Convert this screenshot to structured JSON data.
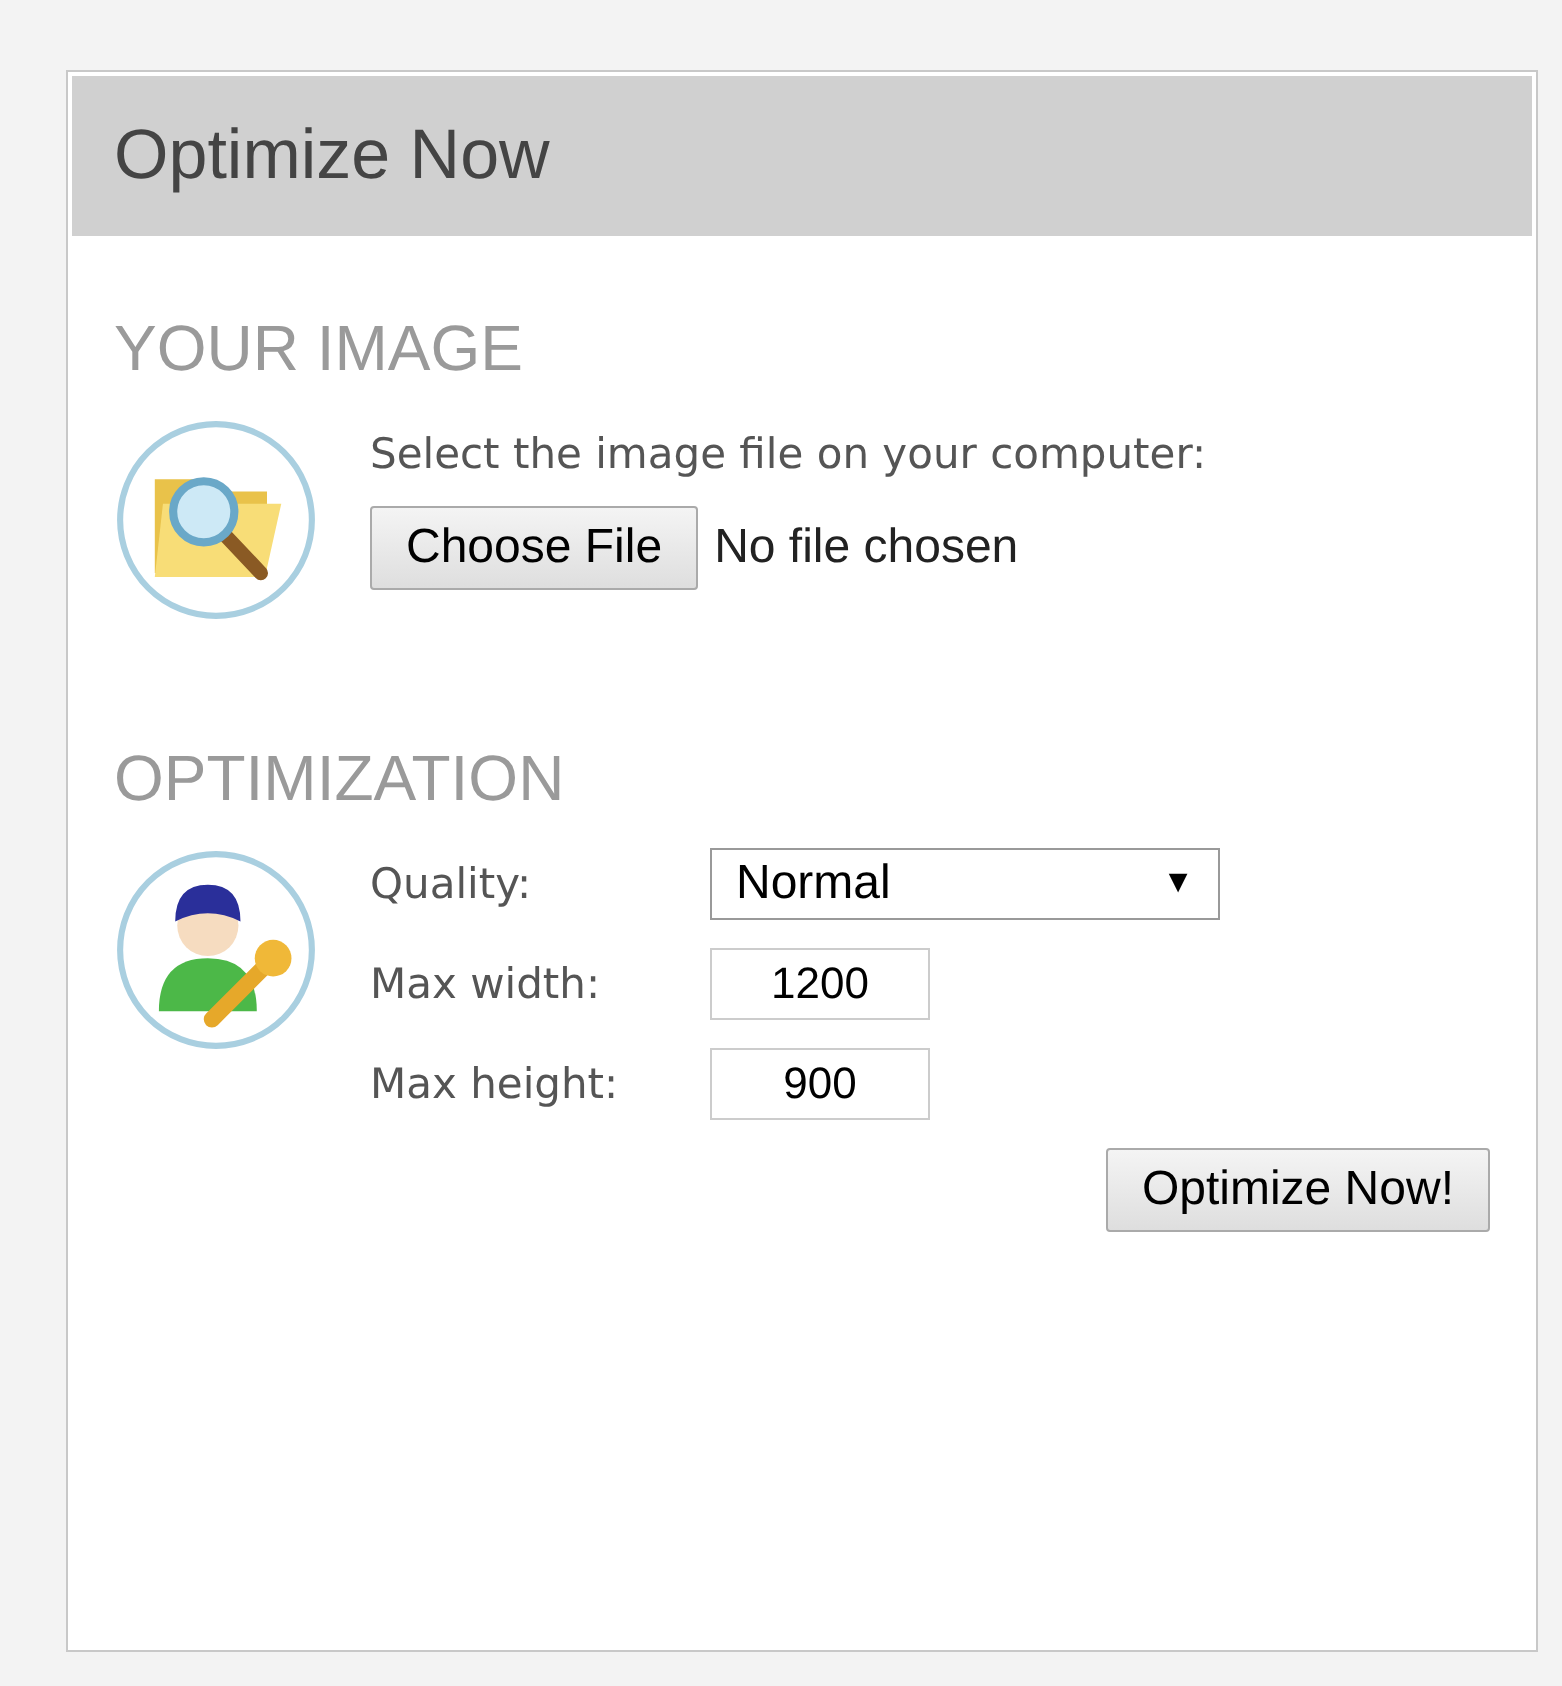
{
  "panel": {
    "title": "Optimize Now"
  },
  "image_section": {
    "heading": "YOUR IMAGE",
    "prompt": "Select the image file on your computer:",
    "file_button": "Choose File",
    "file_status": "No file chosen"
  },
  "optimization_section": {
    "heading": "OPTIMIZATION",
    "fields": [
      {
        "kind": "select",
        "label": "Quality:",
        "value": "Normal",
        "arrow": "▼"
      },
      {
        "kind": "text",
        "label": "Max width:",
        "value": "1200"
      },
      {
        "kind": "text",
        "label": "Max height:",
        "value": "900"
      }
    ],
    "submit_button": "Optimize Now!"
  }
}
